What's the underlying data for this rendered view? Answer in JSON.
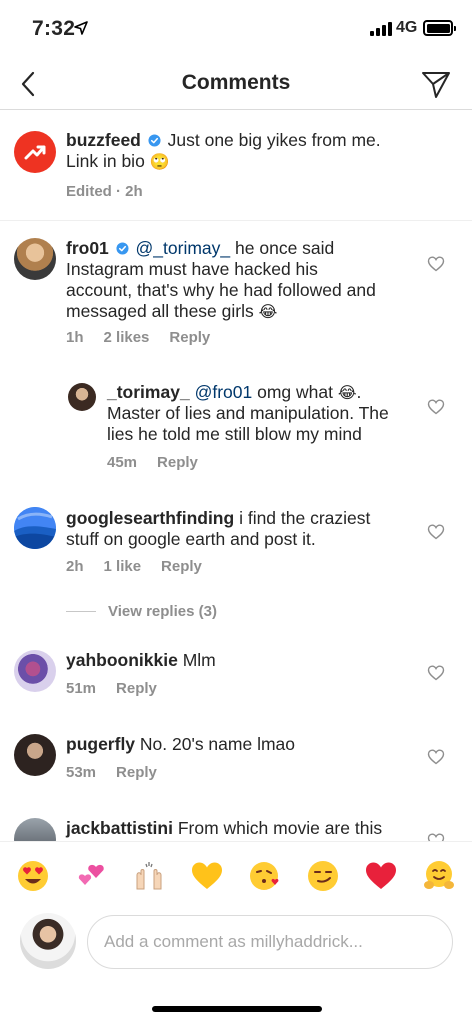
{
  "status_bar": {
    "time": "7:32",
    "network": "4G"
  },
  "nav": {
    "title": "Comments",
    "back_icon": "chevron-left-icon",
    "send_icon": "paper-plane-icon"
  },
  "caption": {
    "username": "buzzfeed",
    "text_line1": "Just one big yikes from me.",
    "text_line2": "Link in bio",
    "text_emoji": "🙄",
    "meta": "Edited · 2h"
  },
  "comments": [
    {
      "username": "fro01",
      "mention": "@_torimay_",
      "lines": [
        "he once said",
        "Instagram must have hacked his",
        "account, that's why he had followed and",
        "messaged all these girls"
      ],
      "emoji": "😂",
      "time": "1h",
      "likes": "2 likes",
      "reply": "Reply"
    },
    {
      "username": "_torimay_",
      "mention": "@fro01",
      "lines": [
        "omg what",
        "Master of lies and manipulation. The",
        "lies he told me still blow my mind"
      ],
      "emoji": "😂",
      "time": "45m",
      "reply": "Reply"
    },
    {
      "username": "googlesearthfinding",
      "lines": [
        "i find the craziest",
        "stuff on google earth and post it."
      ],
      "time": "2h",
      "likes": "1 like",
      "reply": "Reply",
      "view_replies": "View replies (3)"
    },
    {
      "username": "yahboonikkie",
      "text": "Mlm",
      "time": "51m",
      "reply": "Reply"
    },
    {
      "username": "pugerfly",
      "text": "No. 20's name lmao",
      "time": "53m",
      "reply": "Reply"
    },
    {
      "username": "jackbattistini",
      "text": "From which movie are this"
    }
  ],
  "emoji_bar": [
    "😍",
    "💕",
    "🙌",
    "💛",
    "😘",
    "😏",
    "❤️",
    "🤗"
  ],
  "composer": {
    "placeholder": "Add a comment as millyhaddrick..."
  },
  "colors": {
    "accent_verified": "#3897f0",
    "muted": "#8e8e8e",
    "mention": "#00376b",
    "buzzfeed_red": "#ee3322"
  }
}
